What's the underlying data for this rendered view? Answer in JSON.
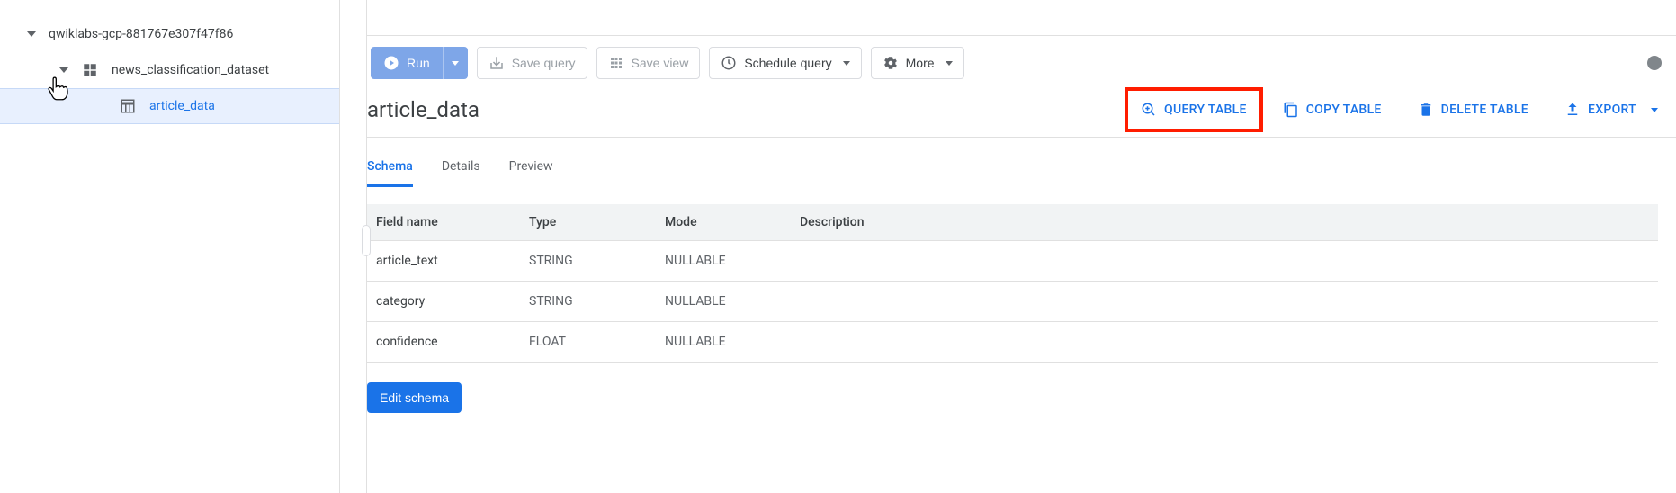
{
  "sidebar": {
    "project": "qwiklabs-gcp-881767e307f47f86",
    "dataset": "news_classification_dataset",
    "table": "article_data"
  },
  "toolbar": {
    "run": "Run",
    "save_query": "Save query",
    "save_view": "Save view",
    "schedule_query": "Schedule query",
    "more": "More"
  },
  "header": {
    "title": "article_data",
    "actions": {
      "query": "QUERY TABLE",
      "copy": "COPY TABLE",
      "delete": "DELETE TABLE",
      "export": "EXPORT"
    }
  },
  "tabs": {
    "schema": "Schema",
    "details": "Details",
    "preview": "Preview"
  },
  "schema": {
    "headers": {
      "field": "Field name",
      "type": "Type",
      "mode": "Mode",
      "description": "Description"
    },
    "rows": [
      {
        "field": "article_text",
        "type": "STRING",
        "mode": "NULLABLE",
        "description": ""
      },
      {
        "field": "category",
        "type": "STRING",
        "mode": "NULLABLE",
        "description": ""
      },
      {
        "field": "confidence",
        "type": "FLOAT",
        "mode": "NULLABLE",
        "description": ""
      }
    ],
    "edit": "Edit schema"
  }
}
